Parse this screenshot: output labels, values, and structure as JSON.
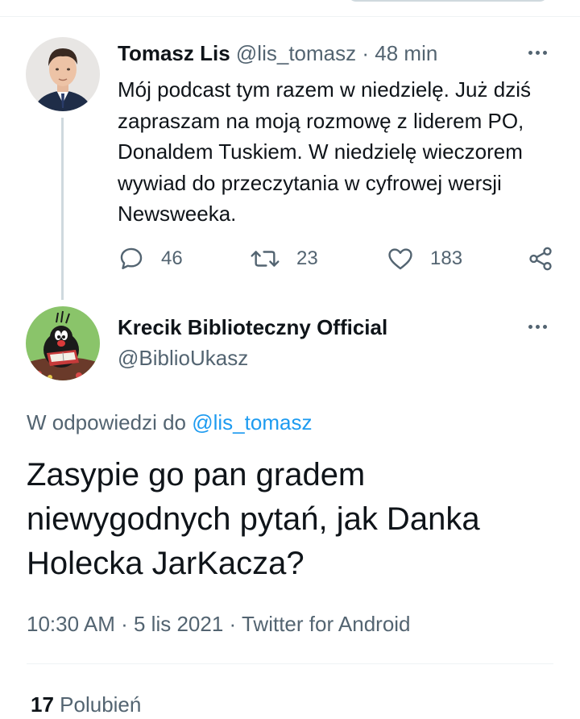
{
  "icons": {
    "more": "more-options-icon",
    "reply": "reply-icon",
    "retweet": "retweet-icon",
    "like": "like-icon",
    "share": "share-icon"
  },
  "colors": {
    "text_primary": "#0f1419",
    "text_secondary": "#536471",
    "link": "#1d9bf0",
    "divider": "#eff3f4",
    "thread_line": "#cfd9de"
  },
  "parent_tweet": {
    "author_name": "Tomasz Lis",
    "author_handle": "@lis_tomasz",
    "separator": "·",
    "time_ago": "48 min",
    "text": "Mój podcast tym razem w niedzielę. Już dziś zapraszam na moją rozmowę z liderem PO, Donaldem Tuskiem. W niedzielę wieczorem wywiad do przeczytania w cyfrowej wersji Newsweeka.",
    "reply_count": "46",
    "retweet_count": "23",
    "like_count": "183"
  },
  "reply_tweet": {
    "author_name": "Krecik Biblioteczny Official",
    "author_handle": "@BiblioUkasz",
    "replying_to_label": "W odpowiedzi do",
    "replying_to_handle": "@lis_tomasz",
    "text": "Zasypie go pan gradem niewygodnych pytań, jak Danka Holecka JarKacza?",
    "time": "10:30 AM",
    "date": "5 lis 2021",
    "source": "Twitter for Android",
    "separator": "·",
    "likes_count": "17",
    "likes_label": "Polubień"
  }
}
